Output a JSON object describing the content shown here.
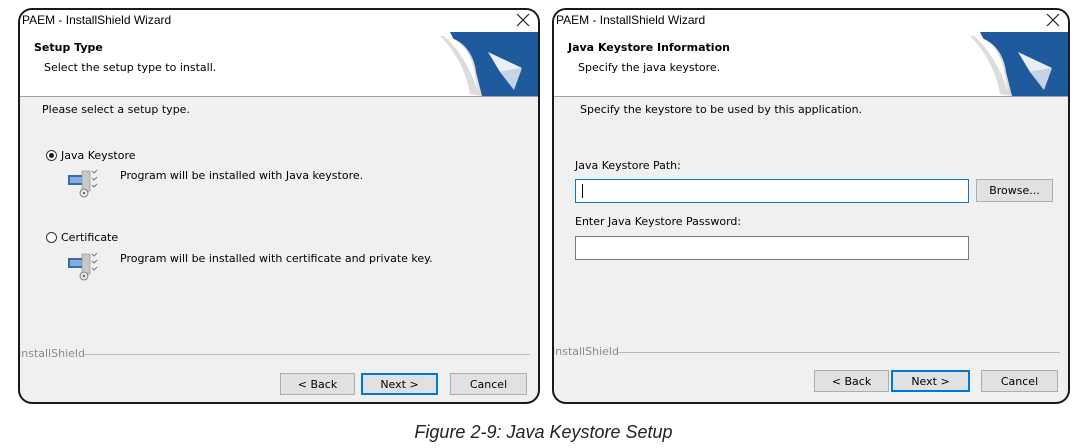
{
  "setup_type": {
    "window_title": "PAEM - InstallShield Wizard",
    "header_title": "Setup Type",
    "header_subtitle": "Select the setup type to install.",
    "prompt": "Please select a setup type.",
    "options": [
      {
        "label": "Java Keystore",
        "description": "Program will be installed with Java keystore.",
        "selected": true
      },
      {
        "label": "Certificate",
        "description": "Program will be installed with certificate and private key.",
        "selected": false
      }
    ],
    "brand": "InstallShield",
    "back_label": "< Back",
    "next_label": "Next >",
    "cancel_label": "Cancel"
  },
  "keystore_info": {
    "window_title": "PAEM - InstallShield Wizard",
    "header_title": "Java Keystore Information",
    "header_subtitle": "Specify the java keystore.",
    "instruction": "Specify the keystore to be used by this application.",
    "path_label": "Java Keystore Path:",
    "path_value": "",
    "browse_label": "Browse...",
    "password_label": "Enter Java Keystore Password:",
    "password_value": "",
    "brand": "InstallShield",
    "back_label": "< Back",
    "next_label": "Next >",
    "cancel_label": "Cancel"
  },
  "caption": "Figure 2-9: Java Keystore Setup",
  "colors": {
    "accent": "#0078d7",
    "logo_blue": "#1e5a9c",
    "dialog_bg": "#f0f0f0"
  }
}
